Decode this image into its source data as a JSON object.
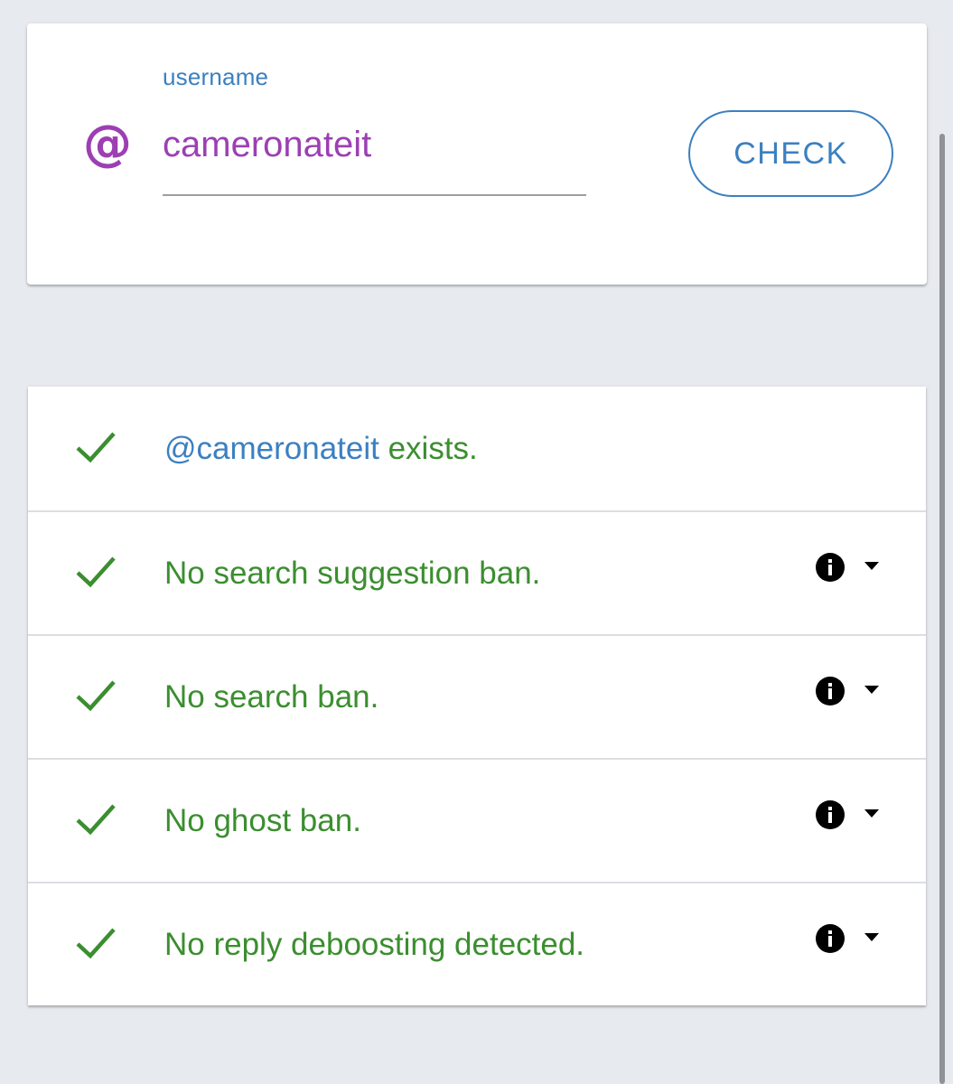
{
  "search": {
    "at_symbol": "@",
    "label": "username",
    "value": "cameronateit",
    "button_label": "CHECK"
  },
  "results": [
    {
      "handle": "@cameronateit",
      "text": "exists.",
      "has_info": false
    },
    {
      "text": "No search suggestion ban.",
      "has_info": true
    },
    {
      "text": "No search ban.",
      "has_info": true
    },
    {
      "text": "No ghost ban.",
      "has_info": true
    },
    {
      "text": "No reply deboosting detected.",
      "has_info": true
    }
  ],
  "colors": {
    "accent_blue": "#3b80c0",
    "accent_purple": "#9c3fb3",
    "success_green": "#3b8e2f",
    "background": "#e7eaef"
  },
  "icons": {
    "status": "check-icon",
    "info": "info-icon",
    "expand": "chevron-down-icon"
  }
}
